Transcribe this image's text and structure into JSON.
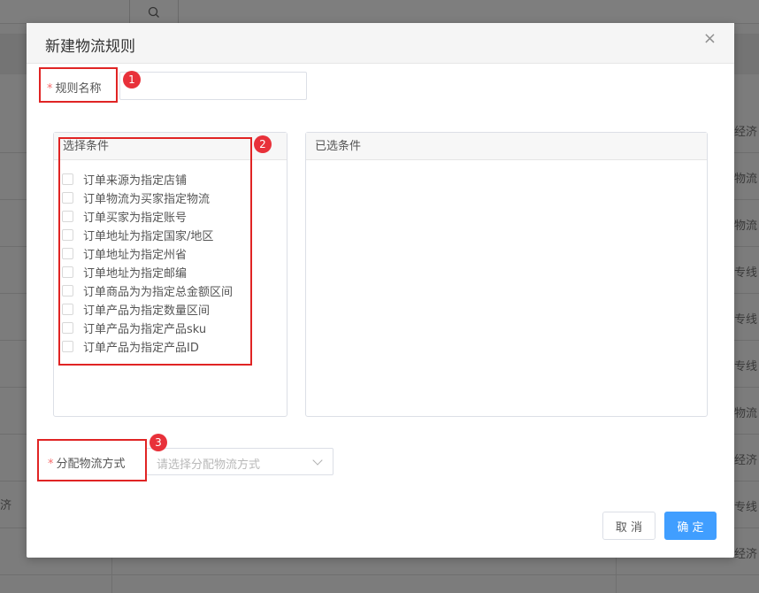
{
  "background": {
    "right_column_cells": [
      "经济",
      "物流",
      "物流",
      "专线",
      "专线",
      "专线",
      "物流",
      "经济",
      "专线",
      "经济"
    ],
    "left_fragment": "济"
  },
  "modal": {
    "title": "新建物流规则",
    "close_glyph": "×"
  },
  "form": {
    "required_mark": "*",
    "rule_name_label": "规则名称",
    "rule_name_value": "",
    "shipping_method_label": "分配物流方式",
    "shipping_method_placeholder": "请选择分配物流方式"
  },
  "conditions": {
    "title": "选择条件",
    "items": [
      "订单来源为指定店铺",
      "订单物流为买家指定物流",
      "订单买家为指定账号",
      "订单地址为指定国家/地区",
      "订单地址为指定州省",
      "订单地址为指定邮编",
      "订单商品为为指定总金额区间",
      "订单产品为指定数量区间",
      "订单产品为指定产品sku",
      "订单产品为指定产品ID"
    ]
  },
  "selected": {
    "title": "已选条件"
  },
  "buttons": {
    "cancel": "取 消",
    "confirm": "确 定"
  },
  "annotations": [
    "1",
    "2",
    "3"
  ],
  "colors": {
    "primary": "#409eff",
    "required": "#f56c6c",
    "annotation_red": "#e02424"
  }
}
